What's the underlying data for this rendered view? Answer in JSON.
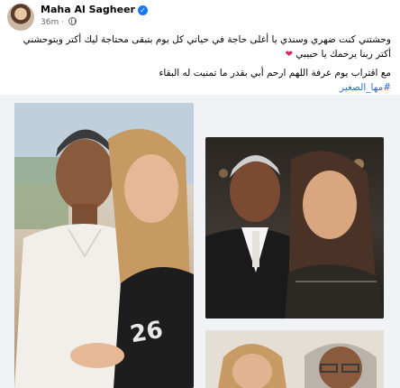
{
  "post": {
    "author": "Maha Al Sagheer",
    "time": "36m",
    "text_line1": "وحشتني كنت ضهري وسندي يا أغلى حاجة في حياتي كل يوم بتبقى محتاجة ليك أكتر وبتوحشني أكتر ربنا يرحمك يا حبيبي",
    "text_line2": "مع اقتراب يوم عرفة اللهم ارحم أبي بقدر ما تمنيت له البقاء",
    "hashtag": "#مها_الصغير"
  },
  "icons": {
    "verified": "verified-badge-icon",
    "audience": "globe-icon",
    "emoji": "heart-icon"
  },
  "colors": {
    "link": "#216fdb",
    "verified": "#1877f2",
    "meta": "#65676b",
    "heart": "#e0245e"
  }
}
